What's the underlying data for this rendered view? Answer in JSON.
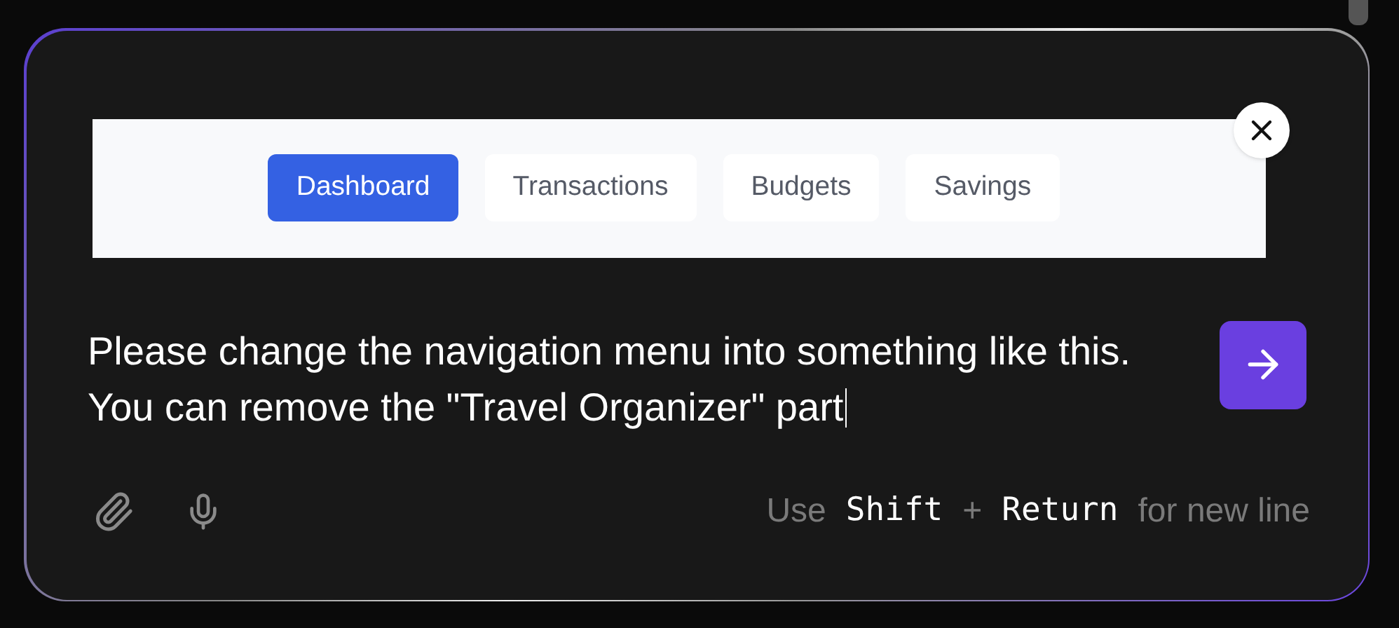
{
  "attachment": {
    "kind": "picture",
    "tabs": [
      {
        "label": "Dashboard",
        "selected": true
      },
      {
        "label": "Transactions",
        "selected": false
      },
      {
        "label": "Budgets",
        "selected": false
      },
      {
        "label": "Savings",
        "selected": false
      }
    ]
  },
  "message": {
    "lines": [
      "Please change the navigation menu into something like this.",
      "You can remove the \"Travel Organizer\" part"
    ]
  },
  "hint": [
    {
      "kind": "text",
      "text": "Use"
    },
    {
      "kind": "key",
      "text": "Shift"
    },
    {
      "kind": "text",
      "text": "+"
    },
    {
      "kind": "key",
      "text": "Return"
    },
    {
      "kind": "text",
      "text": "for new line"
    }
  ]
}
